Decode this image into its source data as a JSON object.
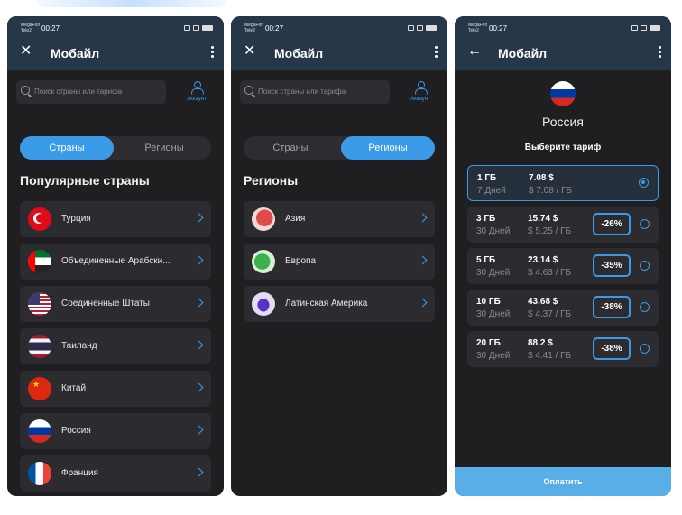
{
  "status": {
    "carrier": "MegaFon Tele2",
    "time": "00:27"
  },
  "screens": [
    {
      "title": "Мобайл",
      "search_placeholder": "Поиск страны или тарифа",
      "account_label": "Аккаунт",
      "tabs": [
        "Страны",
        "Регионы"
      ],
      "active_tab": 0,
      "section": "Популярные страны",
      "items": [
        {
          "label": "Турция",
          "icon": "flag-turkey-icon"
        },
        {
          "label": "Объединенные Арабски...",
          "icon": "flag-uae-icon"
        },
        {
          "label": "Соединенные Штаты",
          "icon": "flag-usa-icon"
        },
        {
          "label": "Таиланд",
          "icon": "flag-thailand-icon"
        },
        {
          "label": "Китай",
          "icon": "flag-china-icon"
        },
        {
          "label": "Россия",
          "icon": "flag-russia-icon"
        },
        {
          "label": "Франция",
          "icon": "flag-france-icon"
        }
      ]
    },
    {
      "title": "Мобайл",
      "search_placeholder": "Поиск страны или тарифа",
      "account_label": "Аккаунт",
      "tabs": [
        "Страны",
        "Регионы"
      ],
      "active_tab": 1,
      "section": "Регионы",
      "items": [
        {
          "label": "Азия",
          "icon": "asia-map-icon"
        },
        {
          "label": "Европа",
          "icon": "europe-map-icon"
        },
        {
          "label": "Латинская Америка",
          "icon": "latin-america-map-icon"
        }
      ]
    },
    {
      "title": "Мобайл",
      "country": "Россия",
      "choose_label": "Выберите тариф",
      "plans": [
        {
          "gb": "1 ГБ",
          "days": "7 Дней",
          "price": "7.08 $",
          "per_gb": "$ 7.08 / ГБ",
          "discount": "",
          "selected": true
        },
        {
          "gb": "3 ГБ",
          "days": "30 Дней",
          "price": "15.74 $",
          "per_gb": "$ 5.25 / ГБ",
          "discount": "-26%",
          "selected": false
        },
        {
          "gb": "5 ГБ",
          "days": "30 Дней",
          "price": "23.14 $",
          "per_gb": "$ 4.63 / ГБ",
          "discount": "-35%",
          "selected": false
        },
        {
          "gb": "10 ГБ",
          "days": "30 Дней",
          "price": "43.68 $",
          "per_gb": "$ 4.37 / ГБ",
          "discount": "-38%",
          "selected": false
        },
        {
          "gb": "20 ГБ",
          "days": "30 Дней",
          "price": "88.2 $",
          "per_gb": "$ 4.41 / ГБ",
          "discount": "-38%",
          "selected": false
        }
      ],
      "pay_label": "Оплатить"
    }
  ],
  "colors": {
    "accent": "#3b9be8",
    "header": "#26374a",
    "background": "#1f1f21",
    "card": "#2c2c30"
  }
}
